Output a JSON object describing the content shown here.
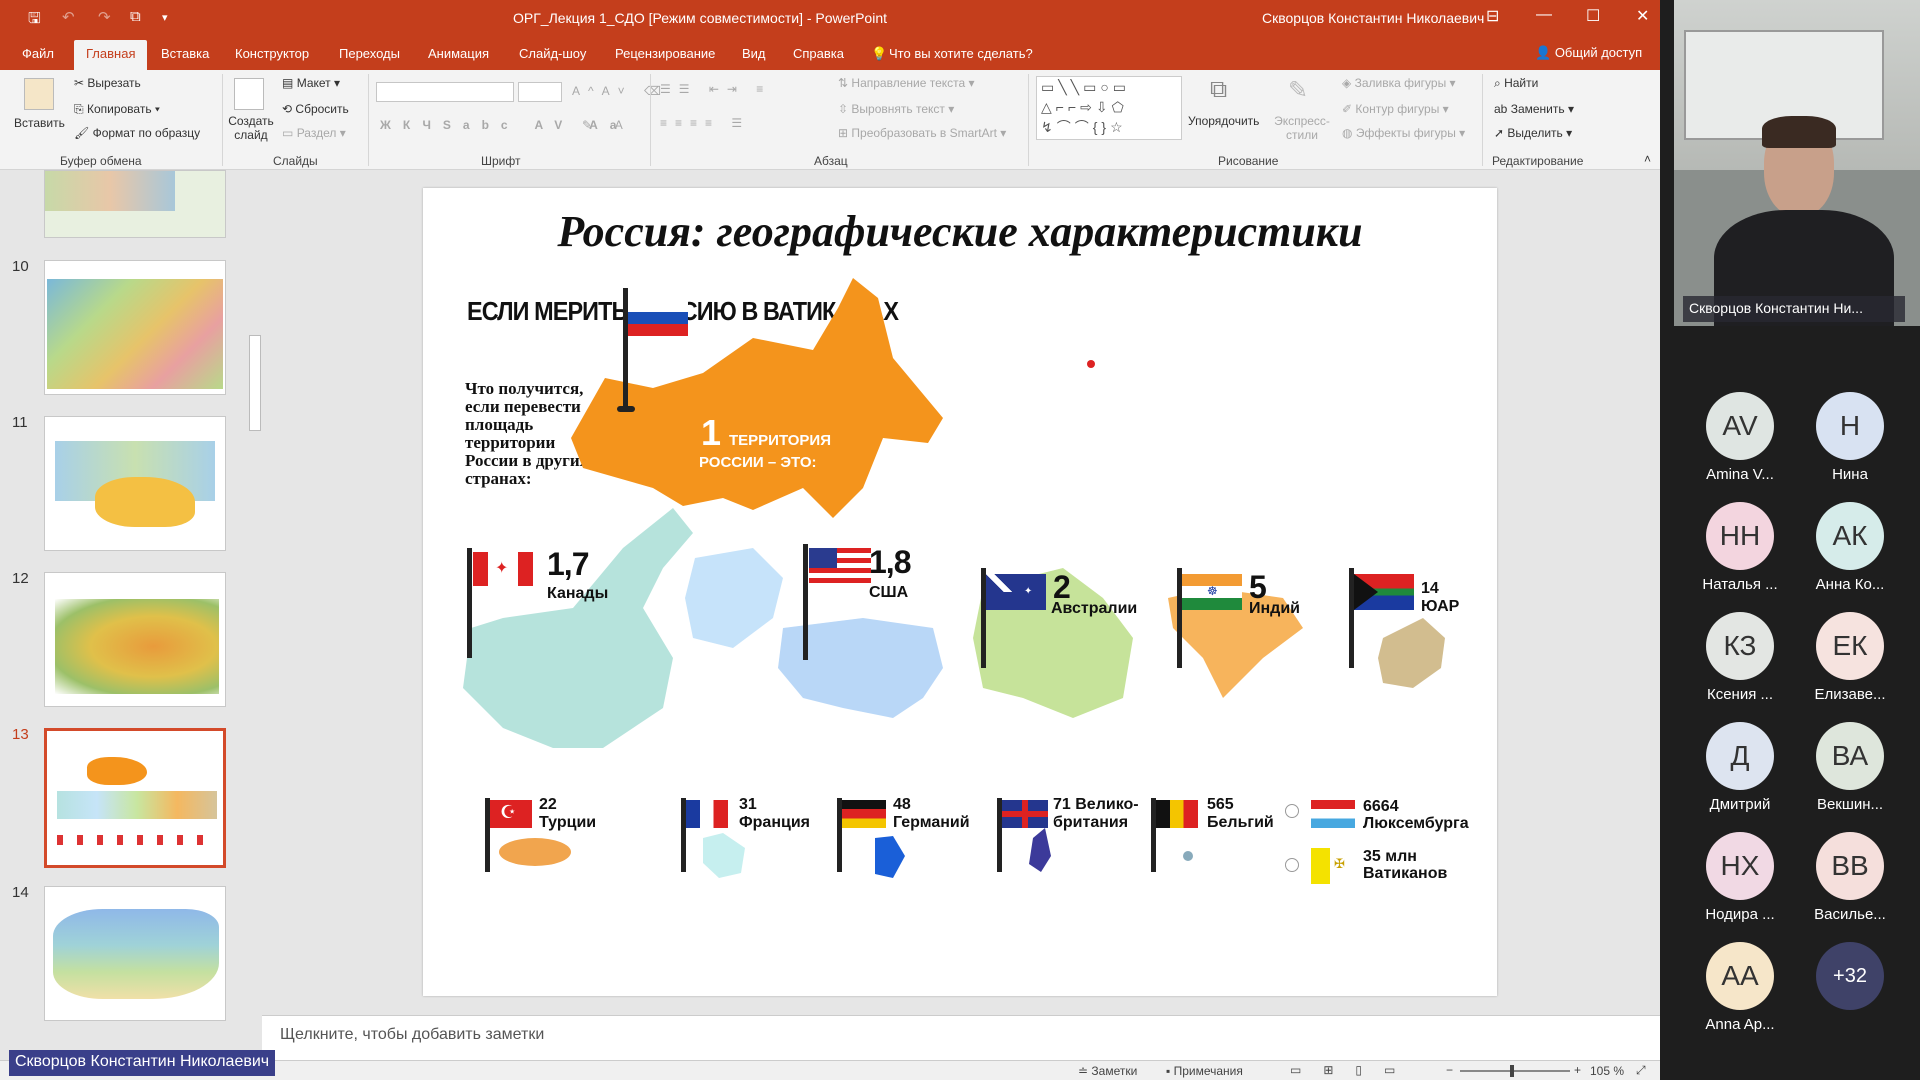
{
  "app": {
    "window_title": "ОРГ_Лекция 1_СДО [Режим совместимости]  -  PowerPoint",
    "user": "Скворцов Константин Николаевич"
  },
  "tabs": [
    "Файл",
    "Главная",
    "Вставка",
    "Конструктор",
    "Переходы",
    "Анимация",
    "Слайд-шоу",
    "Рецензирование",
    "Вид",
    "Справка"
  ],
  "tell_me": "Что вы хотите сделать?",
  "share": "Общий доступ",
  "ribbon": {
    "clipboard": {
      "paste": "Вставить",
      "cut": "Вырезать",
      "copy": "Копировать",
      "format_painter": "Формат по образцу",
      "label": "Буфер обмена"
    },
    "slides": {
      "new_slide": "Создать слайд",
      "layout": "Макет",
      "reset": "Сбросить",
      "section": "Раздел",
      "label": "Слайды"
    },
    "font": {
      "label": "Шрифт"
    },
    "paragraph": {
      "text_direction": "Направление текста",
      "align_text": "Выровнять текст",
      "smartart": "Преобразовать в SmartArt",
      "label": "Абзац"
    },
    "drawing": {
      "arrange": "Упорядочить",
      "quick_styles": "Экспресс-стили",
      "shape_fill": "Заливка фигуры",
      "shape_outline": "Контур фигуры",
      "shape_effects": "Эффекты фигуры",
      "label": "Рисование"
    },
    "editing": {
      "find": "Найти",
      "replace": "Заменить",
      "select": "Выделить",
      "label": "Редактирование"
    }
  },
  "thumbnails": {
    "numbers": [
      "10",
      "11",
      "12",
      "13",
      "14"
    ],
    "selected": "13"
  },
  "slide": {
    "title": "Россия: географические характеристики",
    "subtitle": "ЕСЛИ МЕРИТЬ РОССИЮ В ВАТИКАНАХ",
    "lead": "Что получится, если перевести площадь территории России в других странах:",
    "russia_num": "1",
    "russia_text1": "ТЕРРИТОРИЯ",
    "russia_text2": "РОССИИ – ЭТО:",
    "row1": [
      {
        "num": "1,7",
        "name": "Канады"
      },
      {
        "num": "1,8",
        "name": "США"
      },
      {
        "num": "2",
        "name": "Австралии"
      },
      {
        "num": "5",
        "name": "Индий"
      },
      {
        "num": "14",
        "name": "ЮАР"
      }
    ],
    "row2": [
      {
        "num": "22",
        "name": "Турции"
      },
      {
        "num": "31",
        "name": "Франция"
      },
      {
        "num": "48",
        "name": "Германий"
      },
      {
        "num": "71",
        "name": "Велико-британия"
      },
      {
        "num": "565",
        "name": "Бельгий"
      },
      {
        "num": "6664",
        "name": "Люксембурга"
      },
      {
        "num": "35 млн",
        "name": "Ватиканов"
      }
    ]
  },
  "notes_placeholder": "Щелкните, чтобы добавить заметки",
  "status": {
    "notes": "Заметки",
    "comments": "Примечания",
    "zoom": "105 %"
  },
  "video": {
    "speaker_label": "Скворцов Константин Ни...",
    "bottom_label": "Скворцов Константин Николаевич"
  },
  "participants": [
    {
      "initials": "AV",
      "name": "Amina V...",
      "color": "#dfe5e2"
    },
    {
      "initials": "Н",
      "name": "Нина",
      "color": "#d8e2f2"
    },
    {
      "initials": "НН",
      "name": "Наталья ...",
      "color": "#f3d5df"
    },
    {
      "initials": "АК",
      "name": "Анна Ко...",
      "color": "#d6ecea"
    },
    {
      "initials": "КЗ",
      "name": "Ксения ...",
      "color": "#e3e6e3"
    },
    {
      "initials": "ЕК",
      "name": "Елизаве...",
      "color": "#f6e3df"
    },
    {
      "initials": "Д",
      "name": "Дмитрий",
      "color": "#dde4f0"
    },
    {
      "initials": "ВА",
      "name": "Векшин...",
      "color": "#dee6dc"
    },
    {
      "initials": "НХ",
      "name": "Нодира ...",
      "color": "#f1d9e4"
    },
    {
      "initials": "ВВ",
      "name": "Василье...",
      "color": "#f5dfdc"
    },
    {
      "initials": "АА",
      "name": "Anna Ap...",
      "color": "#f6e6c9"
    },
    {
      "initials": "+32",
      "name": "",
      "color": "#3f4268"
    }
  ]
}
